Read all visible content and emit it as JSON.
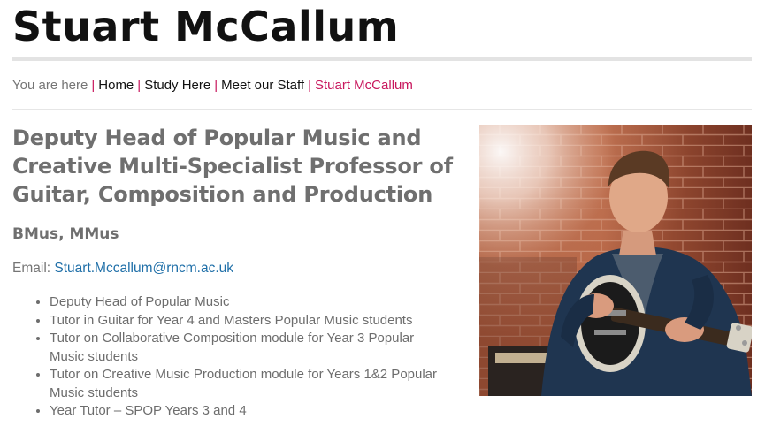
{
  "page": {
    "title": "Stuart McCallum"
  },
  "breadcrumb": {
    "prefix": "You are here",
    "separator": "|",
    "items": [
      "Home",
      "Study Here",
      "Meet our Staff"
    ],
    "current": "Stuart McCallum"
  },
  "profile": {
    "role_title": "Deputy Head of Popular Music and Creative Multi-Specialist Professor of Guitar, Composition and Production",
    "degrees": "BMus, MMus",
    "email_label": "Email:",
    "email": "Stuart.Mccallum@rncm.ac.uk",
    "duties": [
      "Deputy Head of Popular Music",
      "Tutor in Guitar for Year 4 and Masters Popular Music students",
      "Tutor on Collaborative Composition module for Year 3 Popular Music students",
      "Tutor on Creative Music Production module for Years 1&2 Popular Music students",
      "Year Tutor – SPOP Years 3 and 4"
    ]
  },
  "colors": {
    "accent": "#c8175d",
    "link": "#1f6fa8"
  }
}
